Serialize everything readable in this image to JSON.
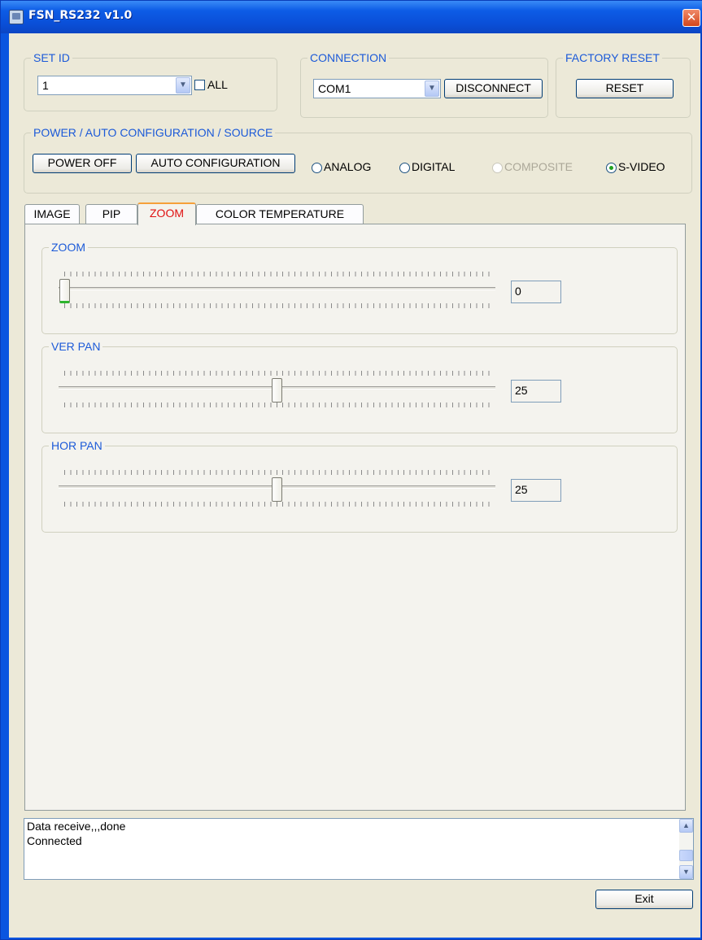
{
  "window": {
    "title": "FSN_RS232 v1.0",
    "close_symbol": "✕"
  },
  "set_id": {
    "title": "SET ID",
    "value": "1",
    "all_label": "ALL",
    "all_checked": false
  },
  "connection": {
    "title": "CONNECTION",
    "port": "COM1",
    "disconnect_label": "DISCONNECT"
  },
  "factory_reset": {
    "title": "FACTORY RESET",
    "reset_label": "RESET"
  },
  "power_group": {
    "title": "POWER / AUTO CONFIGURATION / SOURCE",
    "power_label": "POWER OFF",
    "auto_config_label": "AUTO CONFIGURATION",
    "sources": [
      {
        "label": "ANALOG",
        "checked": false,
        "enabled": true
      },
      {
        "label": "DIGITAL",
        "checked": false,
        "enabled": true
      },
      {
        "label": "COMPOSITE",
        "checked": false,
        "enabled": false
      },
      {
        "label": "S-VIDEO",
        "checked": true,
        "enabled": true
      }
    ]
  },
  "tabs": [
    {
      "label": "IMAGE",
      "active": false
    },
    {
      "label": "PIP",
      "active": false
    },
    {
      "label": "ZOOM",
      "active": true
    },
    {
      "label": "COLOR TEMPERATURE",
      "active": false
    }
  ],
  "zoom_panel": {
    "sliders": [
      {
        "title": "ZOOM",
        "value": "0",
        "position": 0.0
      },
      {
        "title": "VER PAN",
        "value": "25",
        "position": 0.5
      },
      {
        "title": "HOR PAN",
        "value": "25",
        "position": 0.5
      }
    ]
  },
  "log": {
    "lines": [
      "Data receive,,,done",
      "Connected"
    ]
  },
  "footer": {
    "exit_label": "Exit"
  },
  "icons": {
    "dropdown_arrow": "chevron-down-icon",
    "scroll_up": "scroll-up-icon",
    "scroll_down": "scroll-down-icon"
  },
  "colors": {
    "title_bar": "#0a55e0",
    "group_title": "#1c5ad8",
    "active_tab_text": "#e01010",
    "active_tab_highlight": "#f5a03a",
    "client_bg": "#ece9d8"
  }
}
